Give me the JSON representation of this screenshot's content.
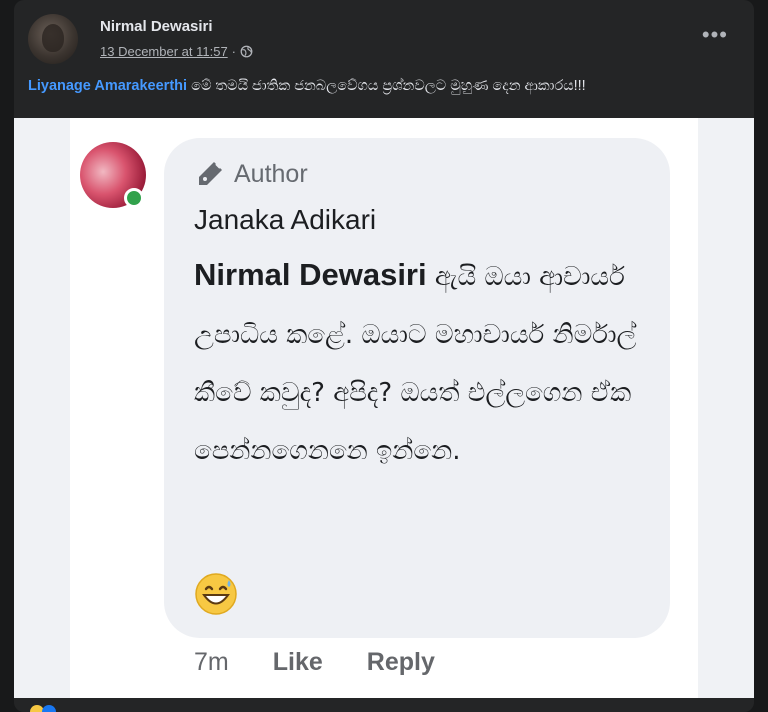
{
  "post": {
    "author_name": "Nirmal Dewasiri",
    "timestamp": "13 December at 11:57",
    "separator": "·",
    "privacy_icon": "globe-icon",
    "more_icon": "more-options-icon",
    "more_label": "•••",
    "caption": {
      "mention": "Liyanage Amarakeerthi",
      "text": " මේ තමයි ජාතික ජනබලවේගය ප්‍රශ්නවලට මුහුණ දෙන ආකාරය!!!"
    }
  },
  "comment": {
    "badge_icon": "pen-icon",
    "badge_label": "Author",
    "author": "Janaka Adikari",
    "mention": "Nirmal Dewasiri",
    "text": " ඇයි ඔයා ආචාර්ය උපාධිය කළේ. ඔයාට මහාචාර්ය නිර්මාල් කීවේ කවුද? අපිද? ඔයත් එල්ලගෙන ඒක පෙන්නගෙනනෙ ඉන්නෙ.",
    "emoji_icon": "grinning-sweat-emoji-icon",
    "time": "7m",
    "like_label": "Like",
    "reply_label": "Reply"
  },
  "colors": {
    "background": "#18191a",
    "card": "#242526",
    "mention_blue": "#4599ff",
    "bubble": "#eef0f4",
    "online_green": "#31a24c"
  }
}
